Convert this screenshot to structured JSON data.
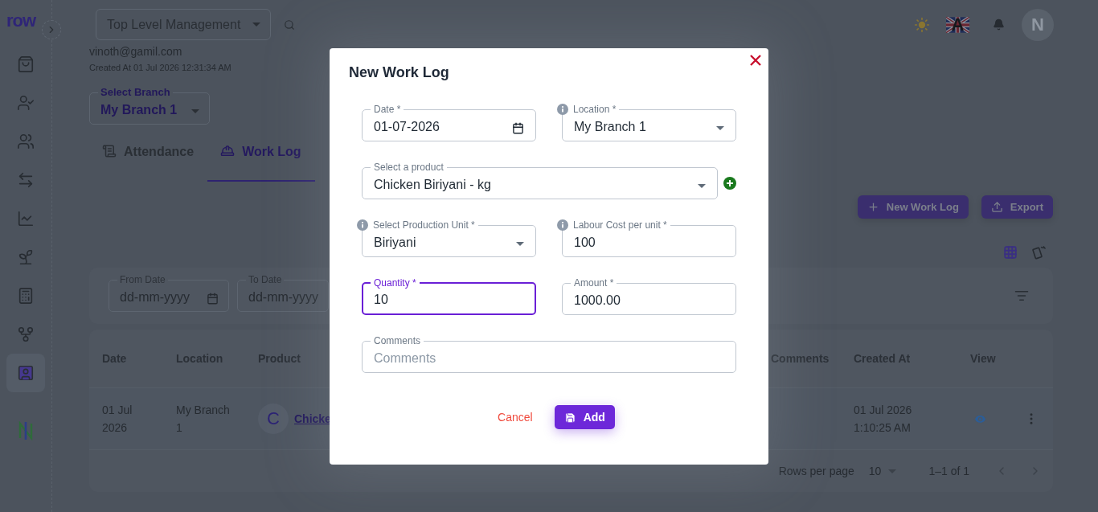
{
  "sidebar": {
    "logo": "row",
    "items": [
      {
        "kind": "bag",
        "selected": false
      },
      {
        "kind": "user-check",
        "selected": false
      },
      {
        "kind": "people",
        "selected": false
      },
      {
        "kind": "swap",
        "selected": false
      },
      {
        "kind": "chart",
        "selected": false
      },
      {
        "kind": "plant",
        "selected": false
      },
      {
        "kind": "calculator",
        "selected": false
      },
      {
        "kind": "fork",
        "selected": false
      },
      {
        "kind": "badge",
        "selected": true
      }
    ]
  },
  "header": {
    "organization": "Top Level Management",
    "language": "A",
    "user_initial": "N"
  },
  "profile": {
    "email": "vinoth@gamil.com",
    "created_at": "Created At 01 Jul 2026 12:31:34 AM"
  },
  "branch_select": {
    "label": "Select Branch",
    "value": "My Branch 1"
  },
  "tabs": [
    {
      "label": "Attendance",
      "kind": "scroll",
      "selected": false
    },
    {
      "label": "Work Log",
      "kind": "worker",
      "selected": true
    }
  ],
  "actions": [
    {
      "label": "New Work Log",
      "kind": "add"
    },
    {
      "label": "Export",
      "kind": "export"
    }
  ],
  "view_modes": [
    {
      "kind": "table",
      "selected": true
    },
    {
      "kind": "cards",
      "selected": false
    }
  ],
  "filters": [
    {
      "label": "From Date",
      "placeholder": "dd-mm-yyyy"
    },
    {
      "label": "To Date",
      "placeholder": "dd-mm-yyyy"
    }
  ],
  "table": {
    "columns": [
      "Date",
      "Location",
      "Product",
      "Comments",
      "Created At",
      "View"
    ],
    "rows": [
      {
        "date": "01 Jul 2026",
        "location": "My Branch 1",
        "product_initial": "C",
        "product": "Chicke",
        "created_at": "01 Jul 2026 1:10:25 AM"
      }
    ]
  },
  "pagination": {
    "rows_per_page_label": "Rows per page",
    "rows_per_page": "10",
    "range": "1–1 of 1"
  },
  "dialog": {
    "title": "New Work Log",
    "rows": [
      [
        {
          "kind": "date",
          "label": "Date *",
          "value": "01-07-2026",
          "info": false,
          "focused": false,
          "add": false
        },
        {
          "kind": "select",
          "label": "Location *",
          "value": "My Branch 1",
          "info": true,
          "focused": false,
          "add": false
        }
      ],
      [
        {
          "kind": "select",
          "label": "Select a product",
          "value": "Chicken Biriyani - kg",
          "info": false,
          "focused": false,
          "add": true
        }
      ],
      [
        {
          "kind": "select",
          "label": "Select Production Unit *",
          "value": "Biriyani",
          "info": true,
          "focused": false,
          "add": false
        },
        {
          "kind": "text",
          "label": "Labour Cost per unit *",
          "value": "100",
          "info": true,
          "focused": false,
          "add": false
        }
      ],
      [
        {
          "kind": "text",
          "label": "Quantity *",
          "value": "10",
          "info": false,
          "focused": true,
          "add": false
        },
        {
          "kind": "text",
          "label": "Amount *",
          "value": "1000.00",
          "info": false,
          "focused": false,
          "add": false
        }
      ],
      [
        {
          "kind": "text",
          "label": "Comments",
          "placeholder": "Comments",
          "info": false,
          "focused": false,
          "add": false
        }
      ]
    ],
    "cancel": "Cancel",
    "submit": "Add"
  }
}
